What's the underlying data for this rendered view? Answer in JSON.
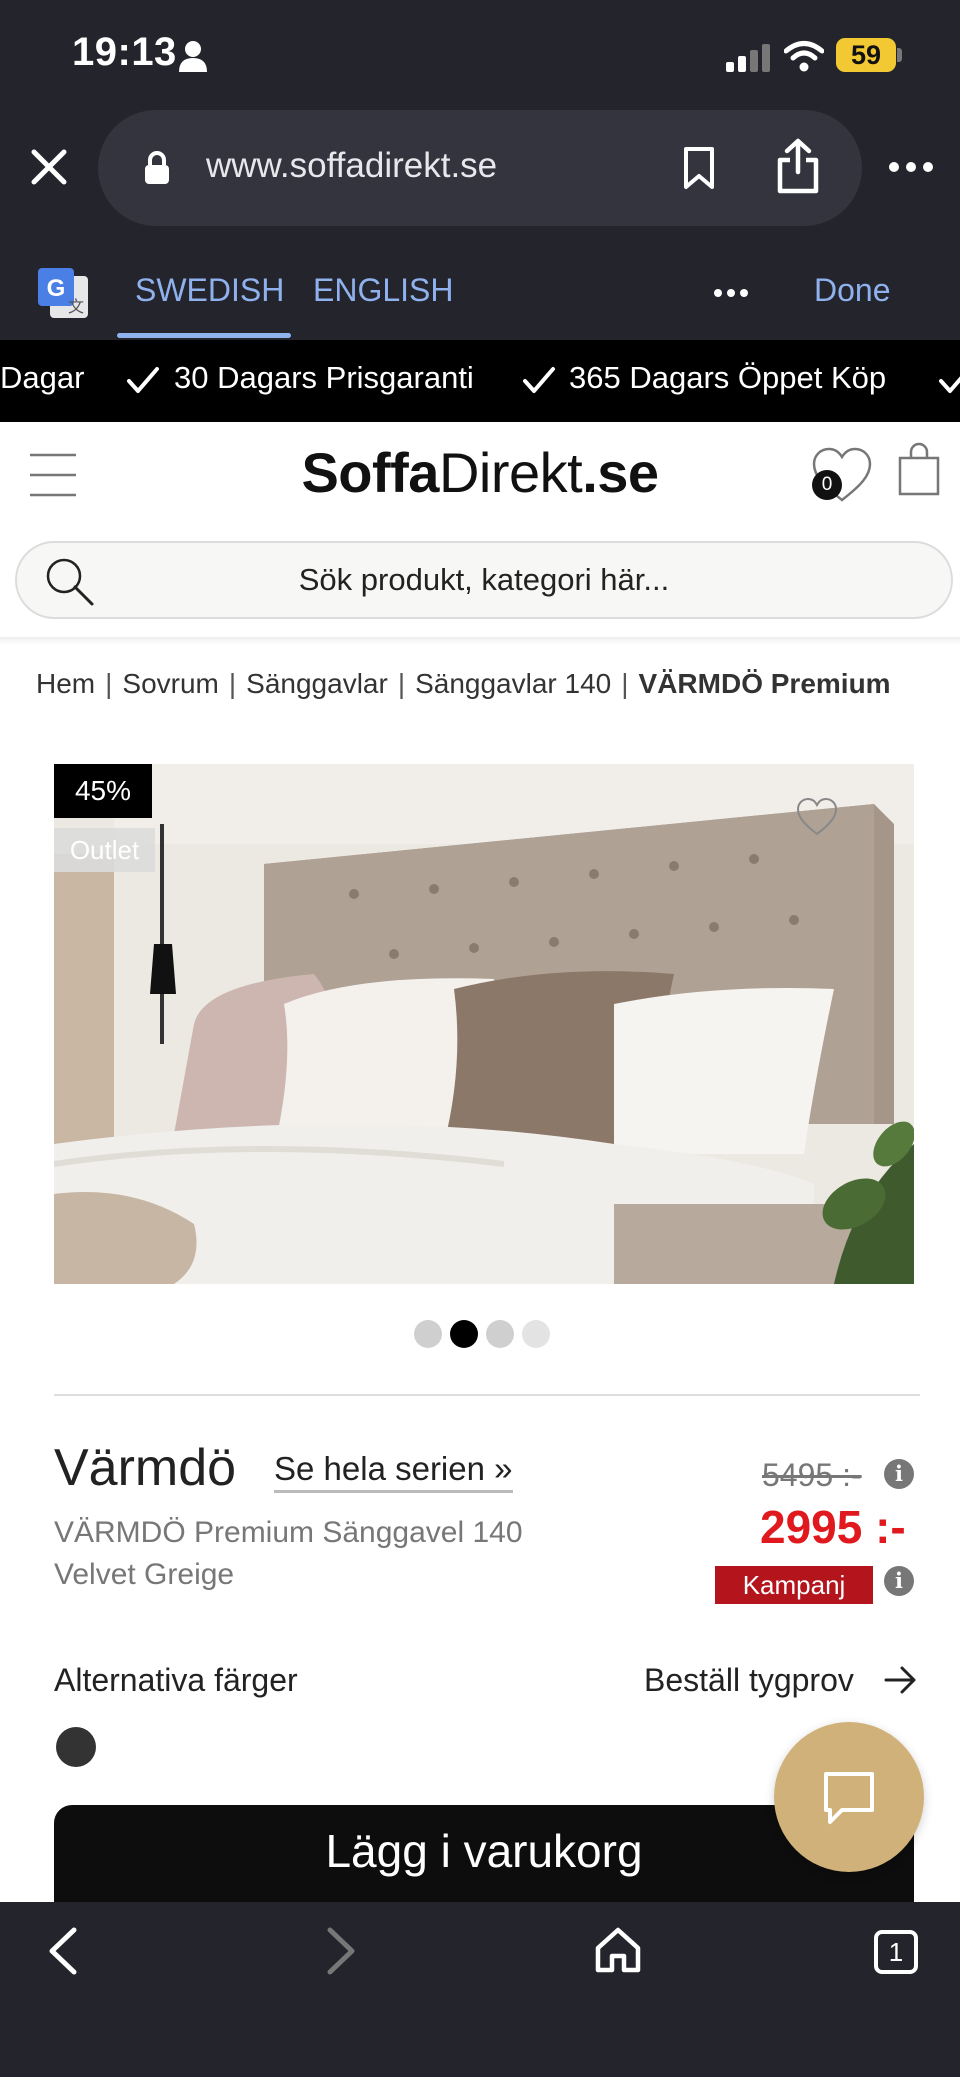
{
  "status": {
    "time": "19:13",
    "battery": "59"
  },
  "browser": {
    "url": "www.soffadirekt.se"
  },
  "translate": {
    "tab_swedish": "SWEDISH",
    "tab_english": "ENGLISH",
    "done": "Done"
  },
  "promo": {
    "items": [
      "Dagar",
      "30 Dagars Prisgaranti",
      "365 Dagars Öppet Köp"
    ]
  },
  "header": {
    "logo_bold1": "Soffa",
    "logo_light": "Direkt",
    "logo_bold2": ".se",
    "wishlist_count": "0",
    "search_placeholder": "Sök produkt, kategori här..."
  },
  "breadcrumb": [
    "Hem",
    "Sovrum",
    "Sänggavlar",
    "Sänggavlar 140",
    "VÄRMDÖ Premium"
  ],
  "image": {
    "discount_badge": "45%",
    "outlet_badge": "Outlet"
  },
  "gallery": {
    "count": 4,
    "active": 1
  },
  "product": {
    "title": "Värmdö",
    "series_link": "Se hela serien »",
    "subtitle": "VÄRMDÖ Premium Sänggavel 140 Velvet Greige",
    "old_price": "5495 :-",
    "new_price": "2995 :-",
    "campaign": "Kampanj",
    "alt_colors": "Alternativa färger",
    "order_sample": "Beställ tygprov",
    "add_to_cart": "Lägg i varukorg"
  },
  "bottom_bar": {
    "tab_count": "1"
  },
  "colors": {
    "chrome": "#24242c",
    "accent_blue": "#8fb1ee",
    "price_red": "#e0191e",
    "campaign_red": "#b4141c",
    "chat_gold": "#d1b17a"
  }
}
